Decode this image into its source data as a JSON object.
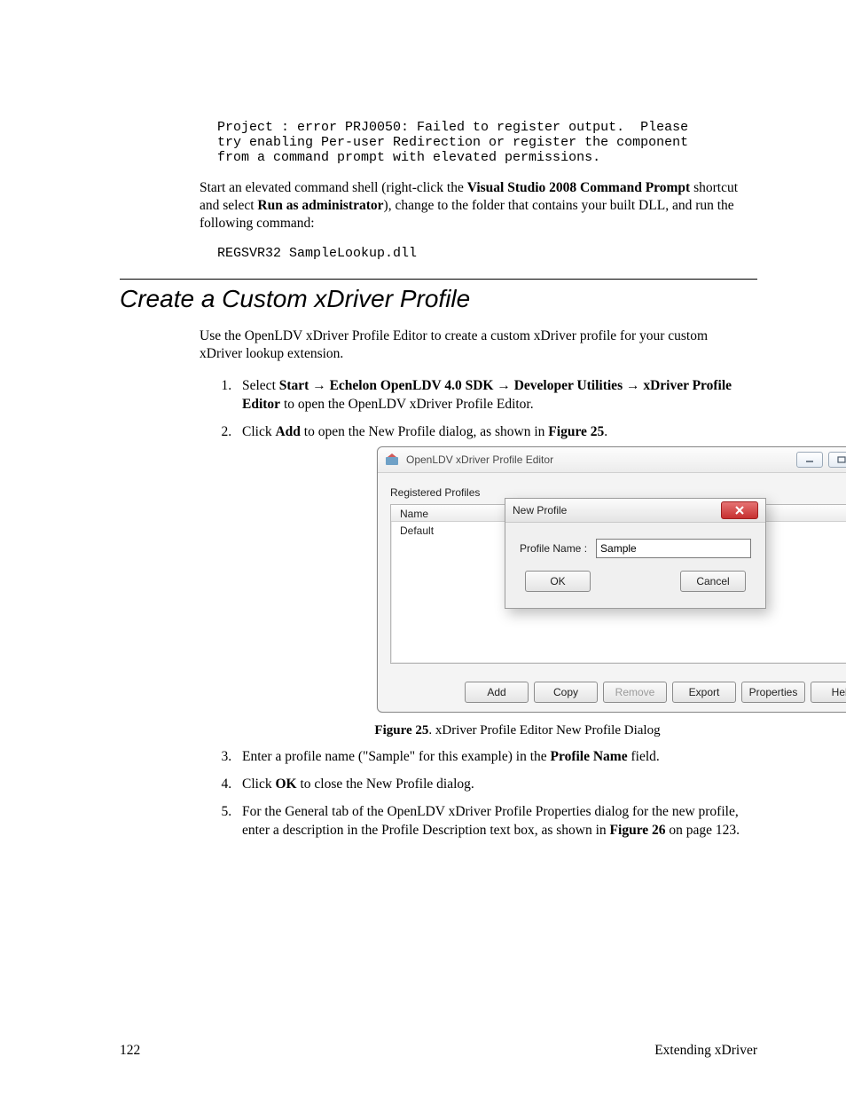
{
  "code_block_1": "Project : error PRJ0050: Failed to register output.  Please\ntry enabling Per-user Redirection or register the component\nfrom a command prompt with elevated permissions.",
  "para1_a": "Start an elevated command shell (right-click the ",
  "para1_b": "Visual Studio 2008 Command Prompt",
  "para1_c": " shortcut and select ",
  "para1_d": "Run as administrator",
  "para1_e": "), change to the folder that contains your built DLL, and run the following command:",
  "code_block_2": "REGSVR32 SampleLookup.dll",
  "section_heading": "Create a Custom xDriver Profile",
  "para2": "Use the OpenLDV xDriver Profile Editor to create a custom xDriver profile for your custom xDriver lookup extension.",
  "step1_a": "Select ",
  "step1_b": "Start → Echelon OpenLDV 4.0 SDK → Developer Utilities → xDriver Profile Editor",
  "step1_c": " to open the OpenLDV xDriver Profile Editor.",
  "step2_a": "Click ",
  "step2_b": "Add",
  "step2_c": " to open the New Profile dialog, as shown in ",
  "step2_d": "Figure 25",
  "step2_e": ".",
  "figure": {
    "window_title": "OpenLDV xDriver Profile Editor",
    "group_label": "Registered Profiles",
    "column_name": "Name",
    "row_default": "Default",
    "modal_title": "New Profile",
    "field_label": "Profile Name :",
    "field_value": "Sample",
    "btn_ok": "OK",
    "btn_cancel": "Cancel",
    "bottom": {
      "add": "Add",
      "copy": "Copy",
      "remove": "Remove",
      "export": "Export",
      "properties": "Properties",
      "help": "Help"
    }
  },
  "figure_caption_a": "Figure 25",
  "figure_caption_b": ". xDriver Profile Editor New Profile Dialog",
  "step3_a": "Enter a profile name (\"Sample\" for this example) in the ",
  "step3_b": "Profile Name",
  "step3_c": " field.",
  "step4_a": "Click ",
  "step4_b": "OK",
  "step4_c": " to close the New Profile dialog.",
  "step5_a": "For the General tab of the OpenLDV xDriver Profile Properties dialog for the new profile, enter a description in the Profile Description text box, as shown in ",
  "step5_b": "Figure 26",
  "step5_c": " on page 123.",
  "footer_page": "122",
  "footer_title": "Extending xDriver"
}
